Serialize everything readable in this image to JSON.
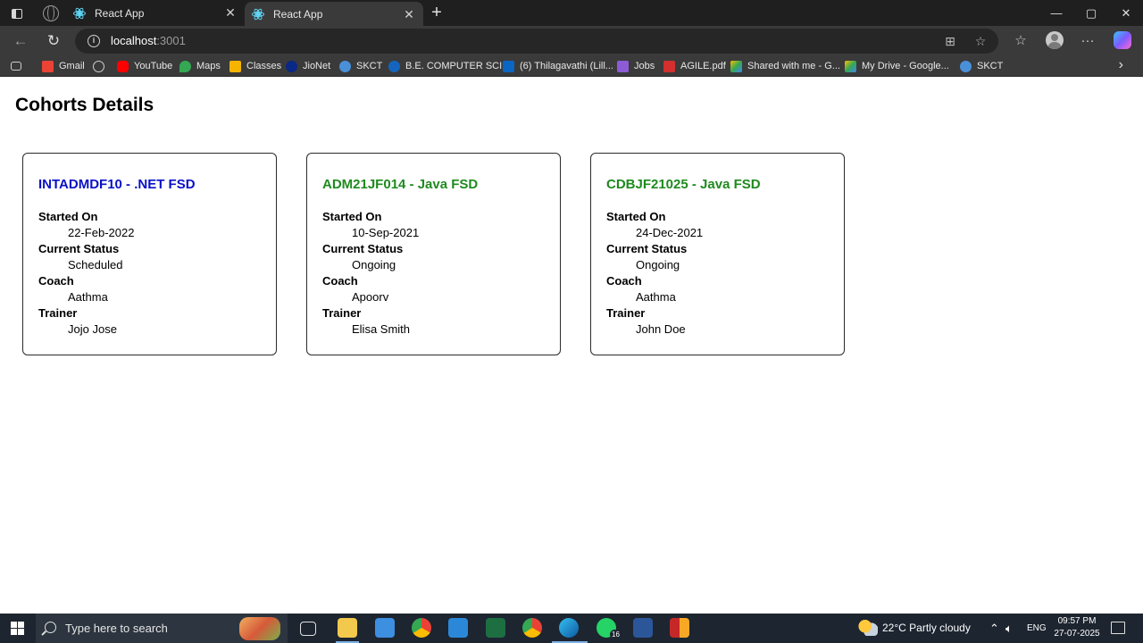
{
  "browser": {
    "tabs": [
      {
        "label": "React App"
      },
      {
        "label": "React App"
      }
    ],
    "address": {
      "host": "localhost",
      "port": ":3001"
    },
    "bookmarks": [
      {
        "label": "Gmail",
        "icon": "gmail-icon",
        "color": "#ea4335"
      },
      {
        "label": "YouTube",
        "icon": "youtube-icon",
        "color": "#ff0000"
      },
      {
        "label": "Maps",
        "icon": "maps-icon",
        "color": "#34a853"
      },
      {
        "label": "Classes",
        "icon": "classroom-icon",
        "color": "#f4b400"
      },
      {
        "label": "JioNet",
        "icon": "jio-icon",
        "color": "#0a2885"
      },
      {
        "label": "SKCT",
        "icon": "skct-icon",
        "color": "#4a90d9"
      },
      {
        "label": "B.E. COMPUTER SCI...",
        "icon": "course-icon",
        "color": "#1565c0"
      },
      {
        "label": "(6) Thilagavathi (Lill...",
        "icon": "linkedin-icon",
        "color": "#0a66c2"
      },
      {
        "label": "Jobs",
        "icon": "jobs-icon",
        "color": "#8e5bd6"
      },
      {
        "label": "AGILE.pdf",
        "icon": "pdf-icon",
        "color": "#d32f2f"
      },
      {
        "label": "Shared with me - G...",
        "icon": "drive-icon",
        "color": "#fbbc04"
      },
      {
        "label": "My Drive - Google...",
        "icon": "drive-icon",
        "color": "#fbbc04"
      },
      {
        "label": "SKCT",
        "icon": "skct-icon",
        "color": "#4a90d9"
      }
    ]
  },
  "page": {
    "title": "Cohorts Details",
    "field_labels": {
      "started_on": "Started On",
      "current_status": "Current Status",
      "coach": "Coach",
      "trainer": "Trainer"
    },
    "cohorts": [
      {
        "title": "INTADMDF10 - .NET FSD",
        "title_color": "#0b11c7",
        "started_on": "22-Feb-2022",
        "current_status": "Scheduled",
        "coach": "Aathma",
        "trainer": "Jojo Jose"
      },
      {
        "title": "ADM21JF014 - Java FSD",
        "title_color": "#1f8a1f",
        "started_on": "10-Sep-2021",
        "current_status": "Ongoing",
        "coach": "Apoorv",
        "trainer": "Elisa Smith"
      },
      {
        "title": "CDBJF21025 - Java FSD",
        "title_color": "#1f8a1f",
        "started_on": "24-Dec-2021",
        "current_status": "Ongoing",
        "coach": "Aathma",
        "trainer": "John Doe"
      }
    ]
  },
  "taskbar": {
    "search_placeholder": "Type here to search",
    "whatsapp_badge": "16",
    "weather": "22°C  Partly cloudy",
    "language": "ENG",
    "time": "09:57 PM",
    "date": "27-07-2025"
  }
}
